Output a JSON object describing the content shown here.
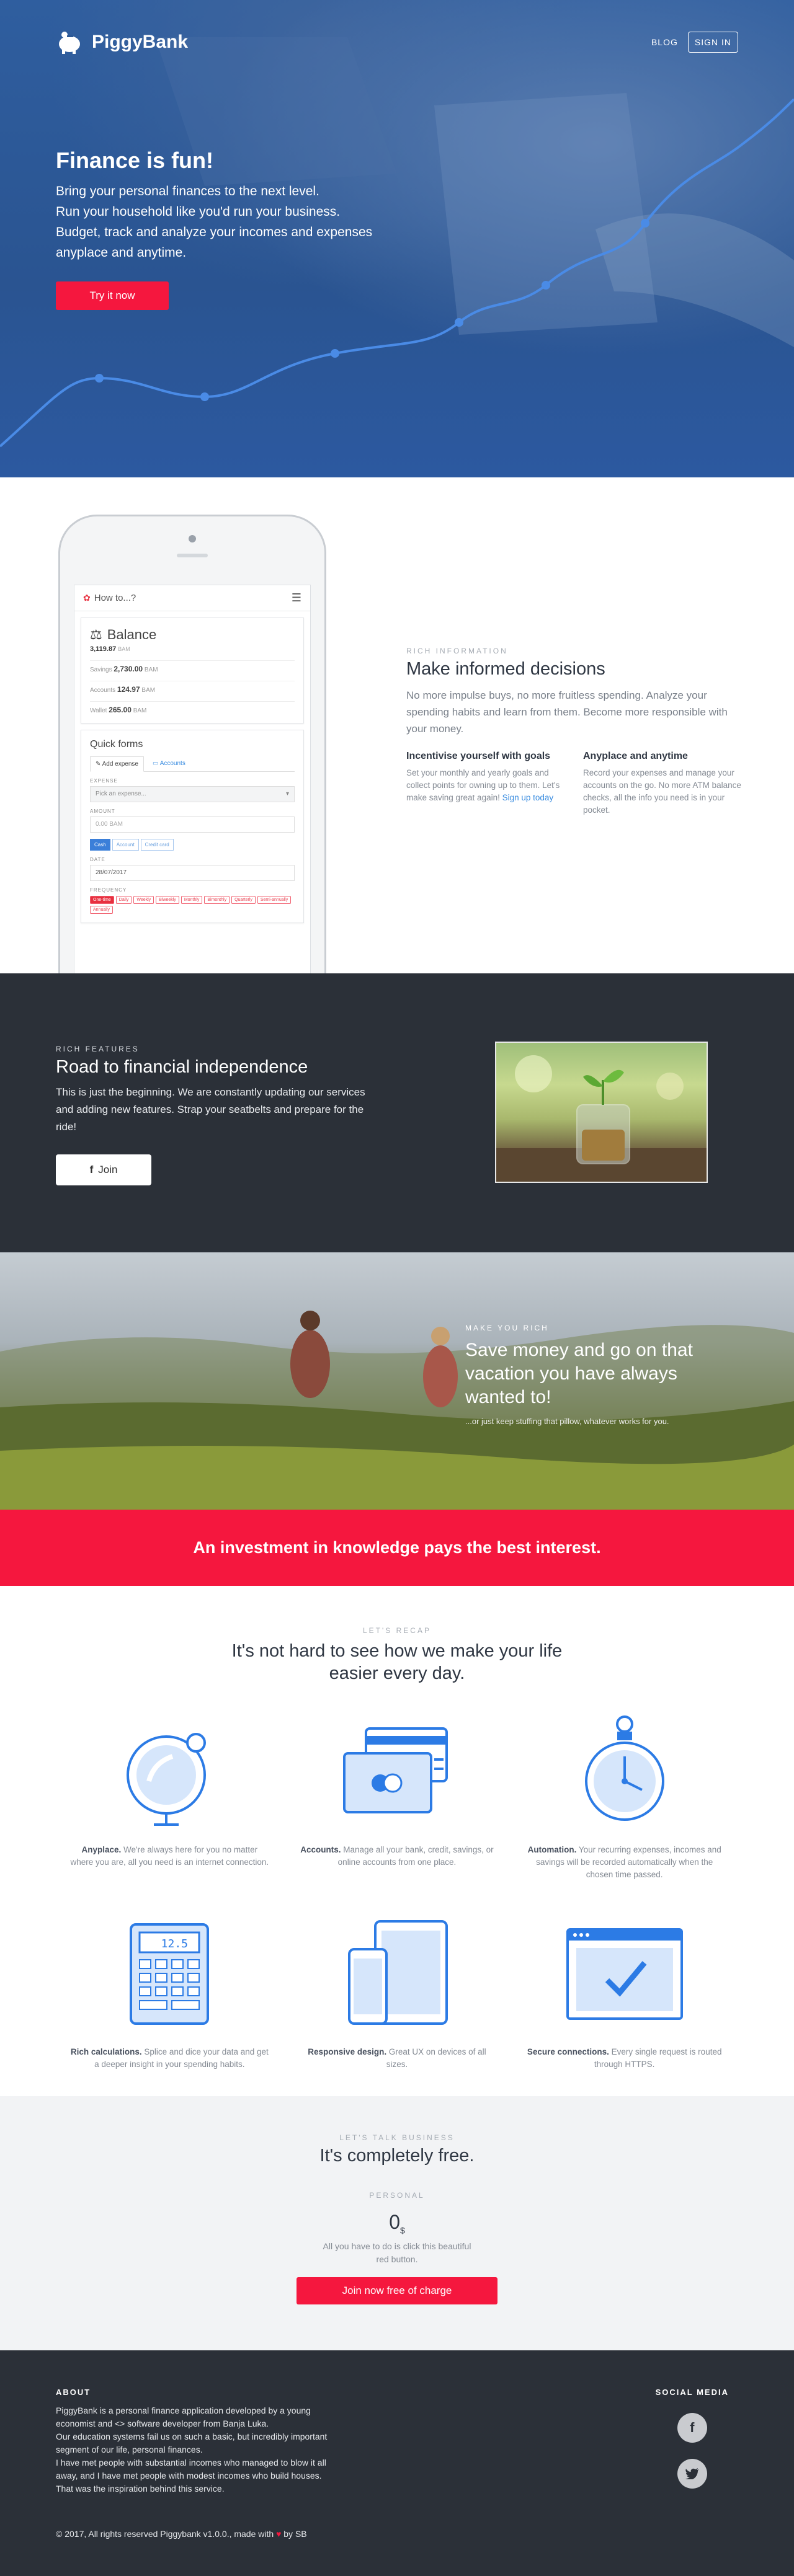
{
  "nav": {
    "brand": "PiggyBank",
    "blog": "BLOG",
    "signin": "SIGN IN"
  },
  "hero": {
    "title": "Finance is fun!",
    "lines": [
      "Bring your personal finances to the next level.",
      "Run your household like you'd run your business.",
      "Budget, track and analyze your incomes and expenses",
      "anyplace and anytime."
    ],
    "cta": "Try it now"
  },
  "phone": {
    "app_title": "How to...?",
    "balance": {
      "title": "Balance",
      "total": "3,119.87",
      "unit": "BAM",
      "rows": [
        {
          "label": "Savings",
          "value": "2,730.00",
          "unit": "BAM"
        },
        {
          "label": "Accounts",
          "value": "124.97",
          "unit": "BAM"
        },
        {
          "label": "Wallet",
          "value": "265.00",
          "unit": "BAM"
        }
      ]
    },
    "quick_forms": {
      "title": "Quick forms",
      "tab_expenses": "Add expense",
      "tab_accounts": "Accounts",
      "expense_label": "EXPENSE",
      "expense_placeholder": "Pick an expense...",
      "amount_label": "AMOUNT",
      "amount_placeholder": "0.00 BAM",
      "pay_buttons": [
        "Cash",
        "Account",
        "Credit card"
      ],
      "date_label": "DATE",
      "date_value": "28/07/2017",
      "frequency_label": "FREQUENCY",
      "frequencies": [
        "One-time",
        "Daily",
        "Weekly",
        "Biweekly",
        "Monthly",
        "Bimonthly",
        "Quarterly",
        "Semi-annually",
        "Annually"
      ]
    }
  },
  "info": {
    "eyebrow": "RICH INFORMATION",
    "title": "Make informed decisions",
    "lead": "No more impulse buys, no more fruitless spending. Analyze your spending habits and learn from them. Become more responsible with your money.",
    "col1_title": "Incentivise yourself with goals",
    "col1_text": "Set your monthly and yearly goals and collect points for owning up to them. Let's make saving great again!",
    "col1_link": "Sign up today",
    "col2_title": "Anyplace and anytime",
    "col2_text": "Record your expenses and manage your accounts on the go. No more ATM balance checks, all the info you need is in your pocket."
  },
  "road": {
    "eyebrow": "RICH FEATURES",
    "title": "Road to financial independence",
    "lead": "This is just the beginning. We are constantly updating our services and adding new features. Strap your seatbelts and prepare for the ride!",
    "join": "Join"
  },
  "travel": {
    "eyebrow": "MAKE YOU RICH",
    "title": "Save money and go on that vacation you have always wanted to!",
    "sub": "...or just keep stuffing that pillow, whatever works for you."
  },
  "band": {
    "text": "An investment in knowledge pays the best interest."
  },
  "recap": {
    "eyebrow": "LET'S RECAP",
    "title": "It's not hard to see how we make your life easier every day.",
    "features": [
      {
        "icon": "globe-icon",
        "bold": "Anyplace.",
        "text": " We're always here for you no matter where you are, all you need is an internet connection."
      },
      {
        "icon": "cards-icon",
        "bold": "Accounts.",
        "text": " Manage all your bank, credit, savings, or online accounts from one place."
      },
      {
        "icon": "stopwatch-icon",
        "bold": "Automation.",
        "text": " Your recurring expenses, incomes and savings will be recorded automatically when the chosen time passed."
      },
      {
        "icon": "calculator-icon",
        "bold": "Rich calculations.",
        "text": " Splice and dice your data and get a deeper insight in your spending habits."
      },
      {
        "icon": "devices-icon",
        "bold": "Responsive design.",
        "text": " Great UX on devices of all sizes."
      },
      {
        "icon": "secure-window-icon",
        "bold": "Secure connections.",
        "text": " Every single request is routed through HTTPS."
      }
    ]
  },
  "pricing": {
    "eyebrow": "LET'S TALK BUSINESS",
    "title": "It's completely free.",
    "plan": "PERSONAL",
    "price": "0",
    "currency": "$",
    "desc": "All you have to do is click this beautiful red button.",
    "cta": "Join now free of charge"
  },
  "footer": {
    "about_head": "ABOUT",
    "about_lines": [
      "PiggyBank is a personal finance application developed by a young economist and <> software developer from Banja Luka.",
      "Our education systems fail us on such a basic, but incredibly important segment of our life, personal finances.",
      "I have met people with substantial incomes who managed to blow it all away, and I have met people with modest incomes who build houses. That was the inspiration behind this service."
    ],
    "social_head": "SOCIAL MEDIA",
    "copyright": "© 2017, All rights reserved Piggybank v1.0.0., made with",
    "copyright_end": "by SB"
  },
  "colors": {
    "accent": "#f5173e",
    "hero_blue": "#2b5896",
    "dark": "#2b3038",
    "link": "#3b8de0"
  }
}
